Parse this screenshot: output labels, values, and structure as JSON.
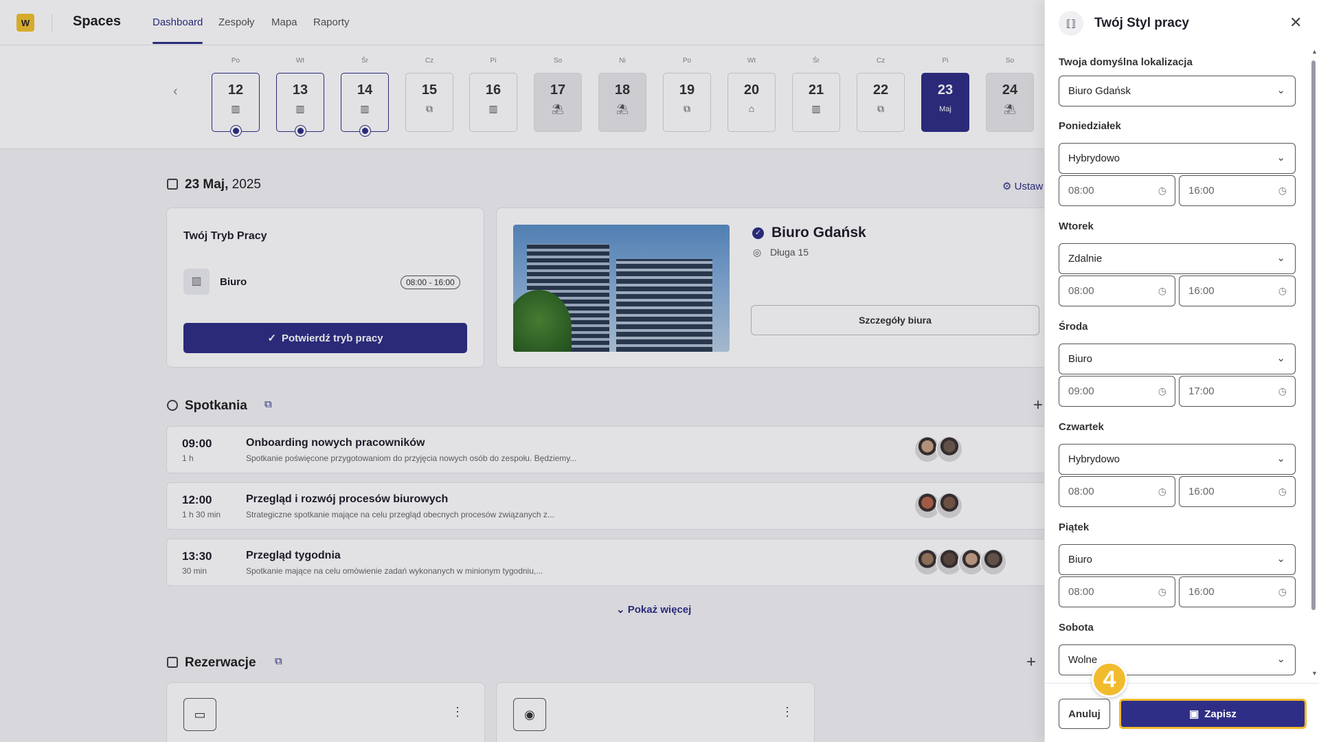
{
  "app": {
    "logo_letter": "W",
    "title": "Spaces"
  },
  "nav": {
    "tabs": [
      "Dashboard",
      "Zespoły",
      "Mapa",
      "Raporty"
    ],
    "active": "Dashboard"
  },
  "calendar": {
    "days": [
      {
        "dn": "Po",
        "num": "12",
        "icon": "office-icon",
        "confirmed": true
      },
      {
        "dn": "Wt",
        "num": "13",
        "icon": "office-icon",
        "confirmed": true
      },
      {
        "dn": "Śr",
        "num": "14",
        "icon": "office-icon",
        "confirmed": true
      },
      {
        "dn": "Cz",
        "num": "15",
        "icon": "hybrid-icon"
      },
      {
        "dn": "Pi",
        "num": "16",
        "icon": "office-icon"
      },
      {
        "dn": "So",
        "num": "17",
        "icon": "beach-icon",
        "weekend": true
      },
      {
        "dn": "Ni",
        "num": "18",
        "icon": "beach-icon",
        "weekend": true
      },
      {
        "dn": "Po",
        "num": "19",
        "icon": "hybrid-icon"
      },
      {
        "dn": "Wt",
        "num": "20",
        "icon": "home-icon"
      },
      {
        "dn": "Śr",
        "num": "21",
        "icon": "office-icon"
      },
      {
        "dn": "Cz",
        "num": "22",
        "icon": "hybrid-icon"
      },
      {
        "dn": "Pi",
        "num": "23",
        "month": "Maj",
        "today": true
      },
      {
        "dn": "So",
        "num": "24",
        "icon": "beach-icon",
        "weekend": true
      }
    ]
  },
  "date_header": {
    "bold": "23 Maj,",
    "rest": " 2025"
  },
  "settings_link": "Ustaw",
  "work_mode": {
    "title": "Twój Tryb Pracy",
    "label": "Biuro",
    "time": "08:00 - 16:00",
    "confirm_label": "Potwierdź tryb pracy"
  },
  "office": {
    "name": "Biuro Gdańsk",
    "address": "Długa 15",
    "details_label": "Szczegóły biura"
  },
  "meetings": {
    "title": "Spotkania",
    "items": [
      {
        "time": "09:00",
        "duration": "1 h",
        "title": "Onboarding nowych pracowników",
        "desc": "Spotkanie poświęcone przygotowaniom do przyjęcia nowych osób do zespołu. Będziemy...",
        "avatars": 2
      },
      {
        "time": "12:00",
        "duration": "1 h 30 min",
        "title": "Przegląd i rozwój procesów biurowych",
        "desc": "Strategiczne spotkanie mające na celu przegląd obecnych procesów związanych z...",
        "avatars": 2
      },
      {
        "time": "13:30",
        "duration": "30 min",
        "title": "Przegląd tygodnia",
        "desc": "Spotkanie mające na celu omówienie zadań wykonanych w minionym tygodniu,...",
        "avatars": 4
      }
    ],
    "show_more": "Pokaż więcej"
  },
  "reservations": {
    "title": "Rezerwacje"
  },
  "panel": {
    "title": "Twój Styl pracy",
    "default_location_label": "Twoja domyślna lokalizacja",
    "default_location": "Biuro Gdańsk",
    "days": [
      {
        "label": "Poniedziałek",
        "mode": "Hybrydowo",
        "start": "08:00",
        "end": "16:00"
      },
      {
        "label": "Wtorek",
        "mode": "Zdalnie",
        "start": "08:00",
        "end": "16:00"
      },
      {
        "label": "Środa",
        "mode": "Biuro",
        "start": "09:00",
        "end": "17:00"
      },
      {
        "label": "Czwartek",
        "mode": "Hybrydowo",
        "start": "08:00",
        "end": "16:00"
      },
      {
        "label": "Piątek",
        "mode": "Biuro",
        "start": "08:00",
        "end": "16:00"
      },
      {
        "label": "Sobota",
        "mode": "Wolne"
      }
    ],
    "cancel_label": "Anuluj",
    "save_label": "Zapisz",
    "step_badge": "4"
  },
  "colors": {
    "accent": "#2e2e86",
    "highlight": "#f2bb2e",
    "logo": "#f2c12e"
  }
}
